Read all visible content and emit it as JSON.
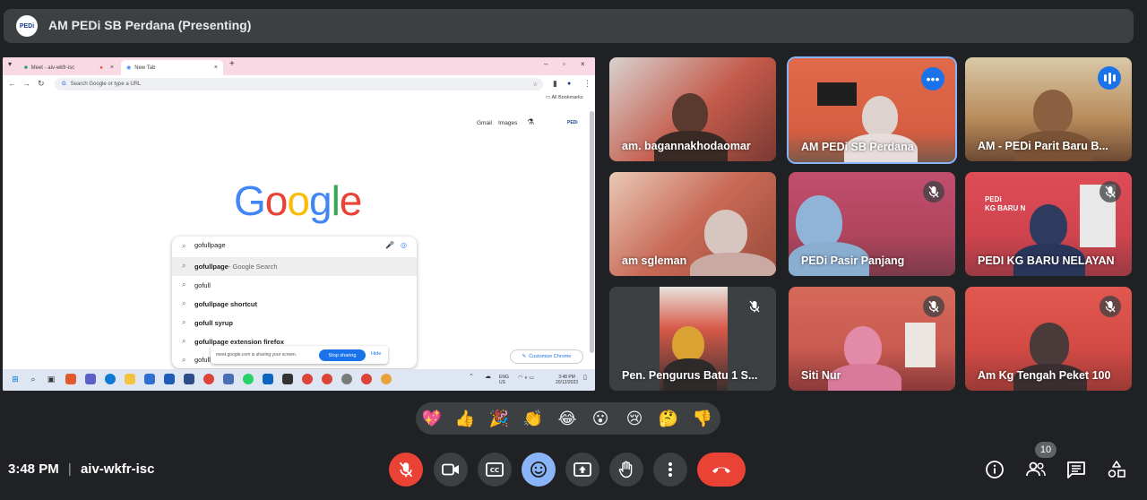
{
  "presenting": {
    "title": "AM PEDi SB Perdana (Presenting)",
    "logo_text": "PEDi"
  },
  "browser": {
    "tabs": [
      {
        "label": "Meet - aiv-wkfr-isc"
      },
      {
        "label": "New Tab"
      }
    ],
    "new_tab_symbol": "+",
    "omnibox_placeholder": "Search Google or type a URL",
    "all_bookmarks": "All Bookmarks",
    "top_links": [
      "Gmail",
      "Images"
    ],
    "google_logo": "Google",
    "search_query": "gofullpage",
    "suggestions": [
      {
        "bold": "gofullpage",
        "rest": " - Google Search"
      },
      {
        "bold": "",
        "rest": "gofull"
      },
      {
        "bold": "gofullpage shortcut",
        "rest": ""
      },
      {
        "bold": "gofull syrup",
        "rest": ""
      },
      {
        "bold": "gofullpage extension firefox",
        "rest": ""
      },
      {
        "bold": "",
        "rest": "gofull"
      }
    ],
    "share_notice": "meet.google.com is sharing your screen.",
    "stop_sharing": "Stop sharing",
    "hide": "Hide",
    "customize_chrome": "Customize Chrome",
    "tray": {
      "lang": "ENG",
      "region": "US",
      "time": "3:48 PM",
      "date": "20/12/2023"
    }
  },
  "participants": [
    {
      "name": "am. bagannakhodaomar",
      "muted": false,
      "bg": "#b8574a"
    },
    {
      "name": "AM PEDi SB Perdana",
      "muted": false,
      "bg": "#d9694b",
      "more": true
    },
    {
      "name": "AM - PEDi Parit Baru B...",
      "muted": false,
      "bg": "#c9a77a",
      "speaking": true
    },
    {
      "name": "am sgleman",
      "muted": false,
      "bg": "#c46a5a"
    },
    {
      "name": "PEDi Pasir Panjang",
      "muted": true,
      "bg": "#b94e6a"
    },
    {
      "name": "PEDI KG BARU NELAYAN",
      "muted": true,
      "bg": "#d84b57"
    },
    {
      "name": "Pen. Pengurus Batu 1 S...",
      "muted": true,
      "bg": "#3c4043"
    },
    {
      "name": "Siti Nur",
      "muted": true,
      "bg": "#c85a5a"
    },
    {
      "name": "Am Kg Tengah Peket 100",
      "muted": true,
      "bg": "#d85550"
    }
  ],
  "reactions": [
    "💖",
    "👍",
    "🎉",
    "👏",
    "😂",
    "😮",
    "😢",
    "🤔",
    "👎"
  ],
  "bottom": {
    "time": "3:48 PM",
    "separator": "|",
    "meeting_code": "aiv-wkfr-isc",
    "participant_count": "10"
  },
  "colors": {
    "background": "#202124",
    "panel": "#3c4043",
    "end_call": "#ea4335",
    "emoji_active": "#8ab4f8",
    "accent": "#1a73e8"
  }
}
